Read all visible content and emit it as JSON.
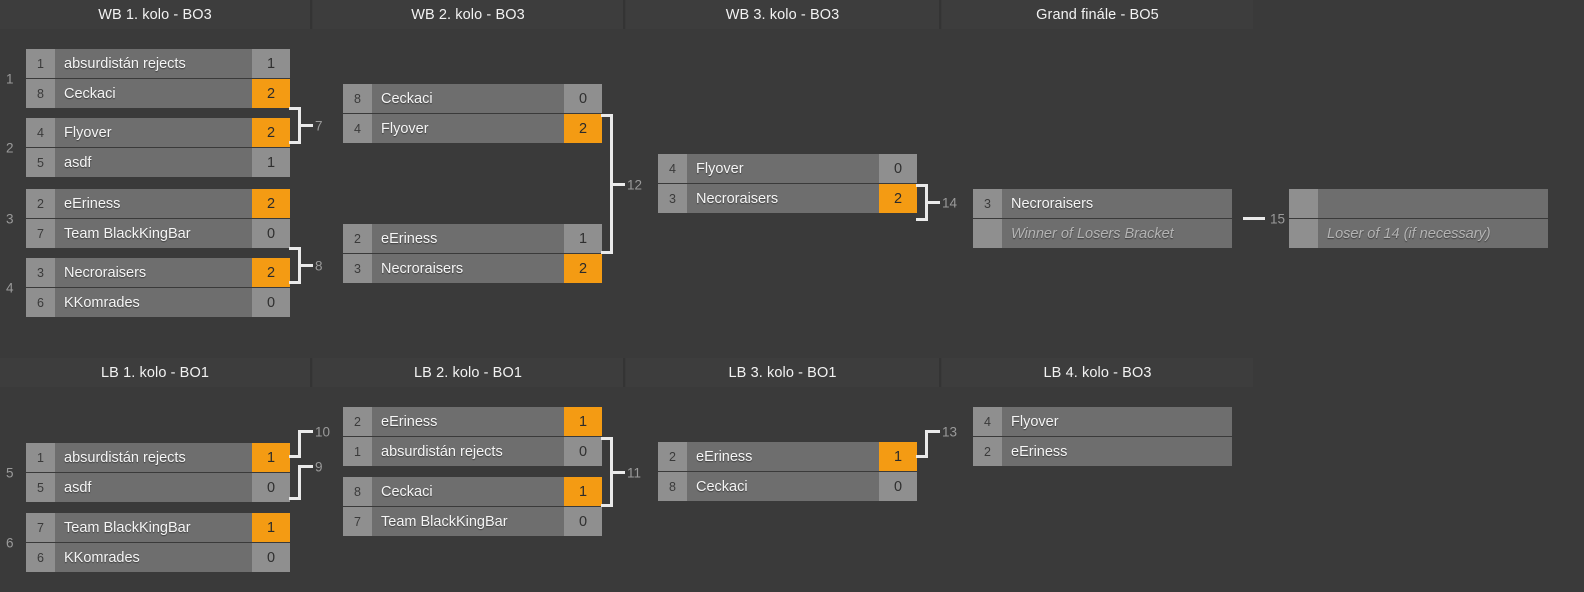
{
  "theme": {
    "background": "#3a3a3a",
    "header_bg": "#3d3d3d",
    "row_bg": "#6e6e6e",
    "seed_bg": "#8f8f8f",
    "score_bg": "#8f8f8f",
    "winner_orange": "#f49b13",
    "connector": "#eaeaea",
    "index_text": "#9a9a9a"
  },
  "winners_bracket": {
    "headers": [
      {
        "label": "WB 1. kolo - BO3"
      },
      {
        "label": "WB 2. kolo - BO3"
      },
      {
        "label": "WB 3. kolo - BO3"
      },
      {
        "label": "Grand finále - BO5"
      }
    ],
    "matches": [
      {
        "number": "1",
        "teams": [
          {
            "seed": "1",
            "name": "absurdistán rejects",
            "score": "1",
            "winner": false
          },
          {
            "seed": "8",
            "name": "Ceckaci",
            "score": "2",
            "winner": true
          }
        ]
      },
      {
        "number": "2",
        "teams": [
          {
            "seed": "4",
            "name": "Flyover",
            "score": "2",
            "winner": true
          },
          {
            "seed": "5",
            "name": "asdf",
            "score": "1",
            "winner": false
          }
        ]
      },
      {
        "number": "3",
        "teams": [
          {
            "seed": "2",
            "name": "eEriness",
            "score": "2",
            "winner": true
          },
          {
            "seed": "7",
            "name": "Team BlackKingBar",
            "score": "0",
            "winner": false
          }
        ]
      },
      {
        "number": "4",
        "teams": [
          {
            "seed": "3",
            "name": "Necroraisers",
            "score": "2",
            "winner": true
          },
          {
            "seed": "6",
            "name": "KKomrades",
            "score": "0",
            "winner": false
          }
        ]
      },
      {
        "number": "7",
        "teams": [
          {
            "seed": "8",
            "name": "Ceckaci",
            "score": "0",
            "winner": false
          },
          {
            "seed": "4",
            "name": "Flyover",
            "score": "2",
            "winner": true
          }
        ]
      },
      {
        "number": "8",
        "teams": [
          {
            "seed": "2",
            "name": "eEriness",
            "score": "1",
            "winner": false
          },
          {
            "seed": "3",
            "name": "Necroraisers",
            "score": "2",
            "winner": true
          }
        ]
      },
      {
        "number": "12",
        "teams": [
          {
            "seed": "4",
            "name": "Flyover",
            "score": "0",
            "winner": false
          },
          {
            "seed": "3",
            "name": "Necroraisers",
            "score": "2",
            "winner": true
          }
        ]
      },
      {
        "number": "14",
        "teams": [
          {
            "seed": "3",
            "name": "Necroraisers",
            "score": "",
            "winner": false
          },
          {
            "seed": "",
            "name": "Winner of Losers Bracket",
            "score": "",
            "winner": false,
            "placeholder": true
          }
        ]
      },
      {
        "number": "15",
        "teams": [
          {
            "seed": "",
            "name": "",
            "score": "",
            "winner": false,
            "empty": true
          },
          {
            "seed": "",
            "name": "Loser of 14 (if necessary)",
            "score": "",
            "winner": false,
            "placeholder": true
          }
        ]
      }
    ]
  },
  "losers_bracket": {
    "headers": [
      {
        "label": "LB 1. kolo - BO1"
      },
      {
        "label": "LB 2. kolo - BO1"
      },
      {
        "label": "LB 3. kolo - BO1"
      },
      {
        "label": "LB 4. kolo - BO3"
      }
    ],
    "matches": [
      {
        "number": "5",
        "teams": [
          {
            "seed": "1",
            "name": "absurdistán rejects",
            "score": "1",
            "winner": true
          },
          {
            "seed": "5",
            "name": "asdf",
            "score": "0",
            "winner": false
          }
        ]
      },
      {
        "number": "6",
        "teams": [
          {
            "seed": "7",
            "name": "Team BlackKingBar",
            "score": "1",
            "winner": true
          },
          {
            "seed": "6",
            "name": "KKomrades",
            "score": "0",
            "winner": false
          }
        ]
      },
      {
        "number": "10",
        "teams": [
          {
            "seed": "2",
            "name": "eEriness",
            "score": "1",
            "winner": true
          },
          {
            "seed": "1",
            "name": "absurdistán rejects",
            "score": "0",
            "winner": false
          }
        ]
      },
      {
        "number": "9",
        "teams": [
          {
            "seed": "8",
            "name": "Ceckaci",
            "score": "1",
            "winner": true
          },
          {
            "seed": "7",
            "name": "Team BlackKingBar",
            "score": "0",
            "winner": false
          }
        ]
      },
      {
        "number": "11",
        "teams": [
          {
            "seed": "2",
            "name": "eEriness",
            "score": "1",
            "winner": true
          },
          {
            "seed": "8",
            "name": "Ceckaci",
            "score": "0",
            "winner": false
          }
        ]
      },
      {
        "number": "13",
        "teams": [
          {
            "seed": "4",
            "name": "Flyover",
            "score": "",
            "winner": false
          },
          {
            "seed": "2",
            "name": "eEriness",
            "score": "",
            "winner": false
          }
        ]
      }
    ]
  },
  "connector_labels": {
    "wb_r1_top": "7",
    "wb_r1_bottom": "8",
    "wb_r2": "12",
    "wb_r3": "14",
    "wb_gf": "15",
    "lb_r1_top": "10",
    "lb_r1_bottom": "9",
    "lb_r2": "11",
    "lb_r3": "13"
  }
}
